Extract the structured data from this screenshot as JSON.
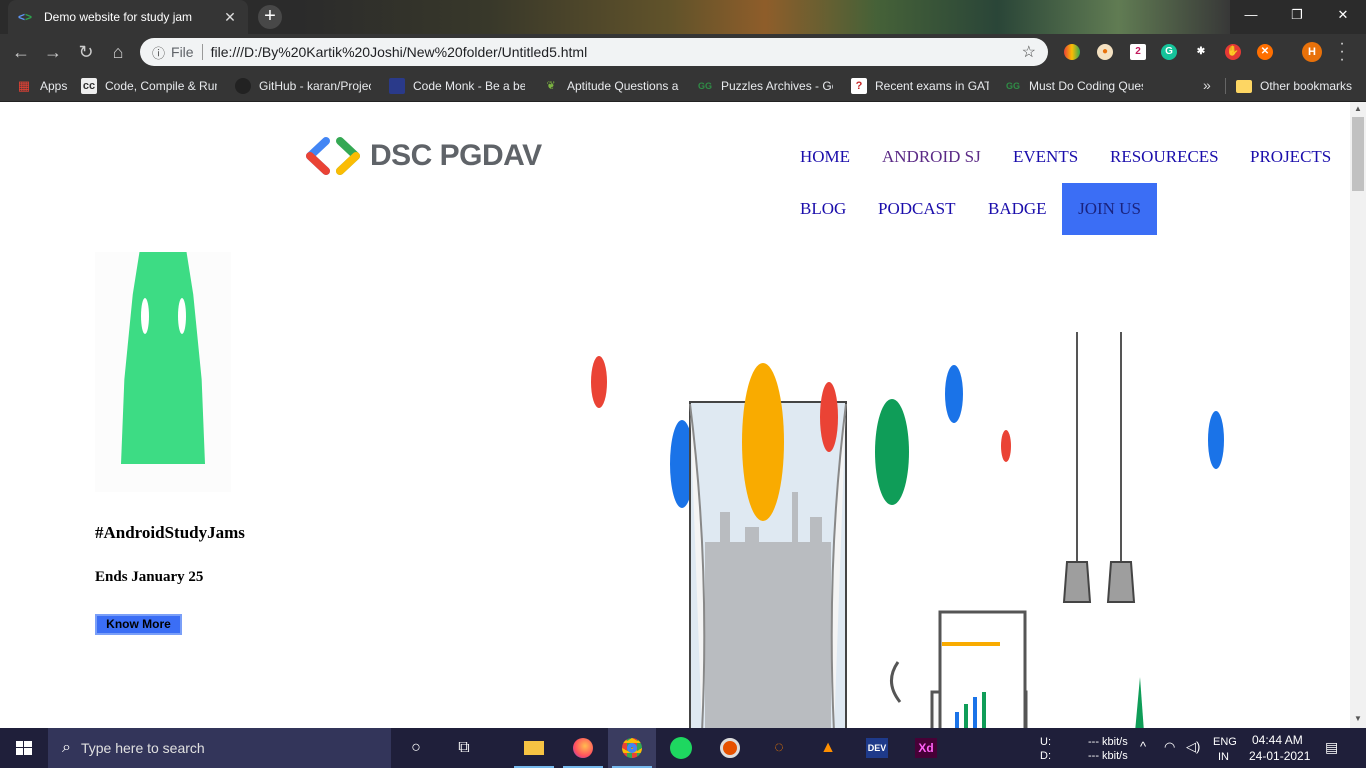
{
  "browser": {
    "tab_title": "Demo website for study jam",
    "tab_close": "✕",
    "new_tab": "+",
    "window_buttons": {
      "minimize": "—",
      "maximize": "❐",
      "close": "✕"
    },
    "omnibox": {
      "scheme_label": "File",
      "url": "file:///D:/By%20Kartik%20Joshi/New%20folder/Untitled5.html"
    },
    "profile_initial": "H",
    "bookmarks": [
      {
        "label": "Apps",
        "icon": "apps-grid-icon"
      },
      {
        "label": "Code, Compile & Run",
        "icon": "cc-icon"
      },
      {
        "label": "GitHub - karan/Projects",
        "icon": "github-icon"
      },
      {
        "label": "Code Monk - Be a better",
        "icon": "codemonk-icon"
      },
      {
        "label": "Aptitude Questions and",
        "icon": "leaf-icon"
      },
      {
        "label": "Puzzles Archives - Gee",
        "icon": "gfg-icon"
      },
      {
        "label": "Recent exams in GATE",
        "icon": "question-icon"
      },
      {
        "label": "Must Do Coding Questions",
        "icon": "gfg-icon"
      }
    ],
    "bookmarks_more": "»",
    "other_bookmarks": "Other bookmarks"
  },
  "site": {
    "logo_text": "DSC PGDAV",
    "nav": {
      "home": "HOME",
      "android_sj": "ANDROID SJ",
      "events": "EVENTS",
      "resources": "RESOURECES",
      "projects": "PROJECTS",
      "blog": "BLOG",
      "podcast": "PODCAST",
      "badge": "BADGE",
      "join_us": "JOIN US"
    },
    "hero": {
      "title": "#AndroidStudyJams",
      "subtitle": "Ends January 25",
      "button": "Know More"
    }
  },
  "taskbar": {
    "search_placeholder": "Type here to search",
    "net_up_label": "U:",
    "net_down_label": "D:",
    "net_up_value": "--- kbit/s",
    "net_down_value": "--- kbit/s",
    "lang_top": "ENG",
    "lang_bottom": "IN",
    "time": "04:44 AM",
    "date": "24-01-2021"
  },
  "colors": {
    "accent_blue": "#3b6ef5",
    "android_green": "#3ddc84",
    "google_red": "#ea4335",
    "google_yellow": "#fbbc04",
    "google_green": "#34a853",
    "google_blue": "#4285f4"
  }
}
